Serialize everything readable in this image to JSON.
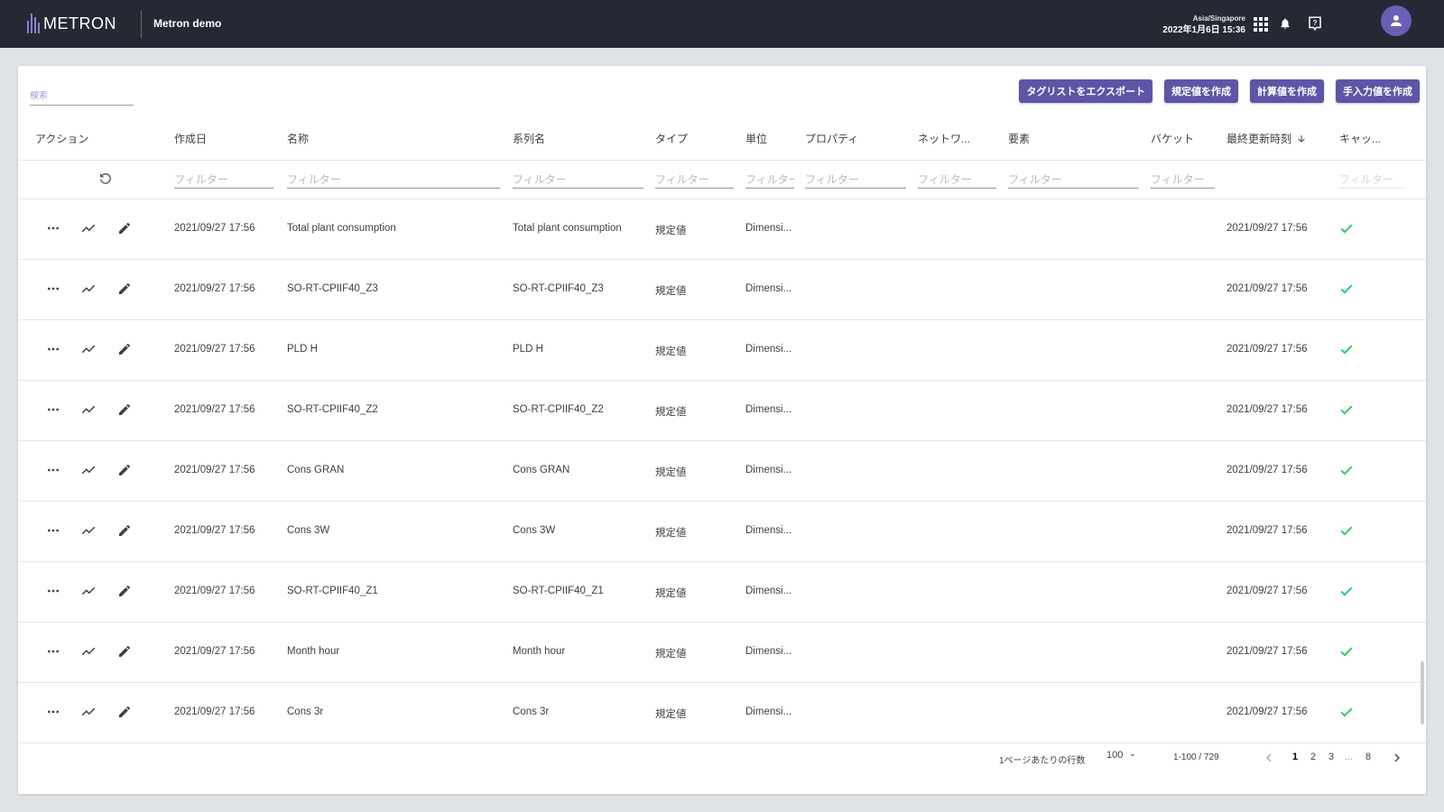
{
  "header": {
    "logo_text": "METRON",
    "workspace": "Metron demo",
    "timezone": "Asia/Singapore",
    "datetime": "2022年1月6日 15:36",
    "icons": [
      "apps-grid-icon",
      "bell-icon",
      "help-icon",
      "user-avatar-icon"
    ]
  },
  "search": {
    "placeholder": "検索"
  },
  "buttons": {
    "export": "タグリストをエクスポート",
    "create_rule": "規定値を作成",
    "create_calc": "計算値を作成",
    "create_manual": "手入力値を作成"
  },
  "columns": {
    "actions": "アクション",
    "created": "作成日",
    "name": "名称",
    "series": "系列名",
    "type": "タイプ",
    "unit": "単位",
    "property": "プロパティ",
    "network": "ネットワ...",
    "element": "要素",
    "bucket": "バケット",
    "updated": "最終更新時刻",
    "cache": "キャッ..."
  },
  "filter_placeholder": "フィルター",
  "filter_unit": "フィルター",
  "rows": [
    {
      "created": "2021/09/27 17:56",
      "name": "Total plant consumption",
      "series": "Total plant consumption",
      "type": "規定値",
      "unit": "Dimensi...",
      "updated": "2021/09/27 17:56",
      "cache": true
    },
    {
      "created": "2021/09/27 17:56",
      "name": "SO-RT-CPIIF40_Z3",
      "series": "SO-RT-CPIIF40_Z3",
      "type": "規定値",
      "unit": "Dimensi...",
      "updated": "2021/09/27 17:56",
      "cache": true
    },
    {
      "created": "2021/09/27 17:56",
      "name": "PLD H",
      "series": "PLD H",
      "type": "規定値",
      "unit": "Dimensi...",
      "updated": "2021/09/27 17:56",
      "cache": true
    },
    {
      "created": "2021/09/27 17:56",
      "name": "SO-RT-CPIIF40_Z2",
      "series": "SO-RT-CPIIF40_Z2",
      "type": "規定値",
      "unit": "Dimensi...",
      "updated": "2021/09/27 17:56",
      "cache": true
    },
    {
      "created": "2021/09/27 17:56",
      "name": "Cons GRAN",
      "series": "Cons GRAN",
      "type": "規定値",
      "unit": "Dimensi...",
      "updated": "2021/09/27 17:56",
      "cache": true
    },
    {
      "created": "2021/09/27 17:56",
      "name": "Cons 3W",
      "series": "Cons 3W",
      "type": "規定値",
      "unit": "Dimensi...",
      "updated": "2021/09/27 17:56",
      "cache": true
    },
    {
      "created": "2021/09/27 17:56",
      "name": "SO-RT-CPIIF40_Z1",
      "series": "SO-RT-CPIIF40_Z1",
      "type": "規定値",
      "unit": "Dimensi...",
      "updated": "2021/09/27 17:56",
      "cache": true
    },
    {
      "created": "2021/09/27 17:56",
      "name": "Month hour",
      "series": "Month hour",
      "type": "規定値",
      "unit": "Dimensi...",
      "updated": "2021/09/27 17:56",
      "cache": true
    },
    {
      "created": "2021/09/27 17:56",
      "name": "Cons 3r",
      "series": "Cons 3r",
      "type": "規定値",
      "unit": "Dimensi...",
      "updated": "2021/09/27 17:56",
      "cache": true
    }
  ],
  "pagination": {
    "rows_per_page_label": "1ページあたりの行数",
    "rows_per_page": "100",
    "range": "1-100 / 729",
    "pages": [
      "1",
      "2",
      "3"
    ],
    "ellipsis": "...",
    "last_page": "8",
    "current_page": "1"
  },
  "colors": {
    "topbar": "#262833",
    "accent": "#5d55a6",
    "check": "#2ecc71"
  }
}
